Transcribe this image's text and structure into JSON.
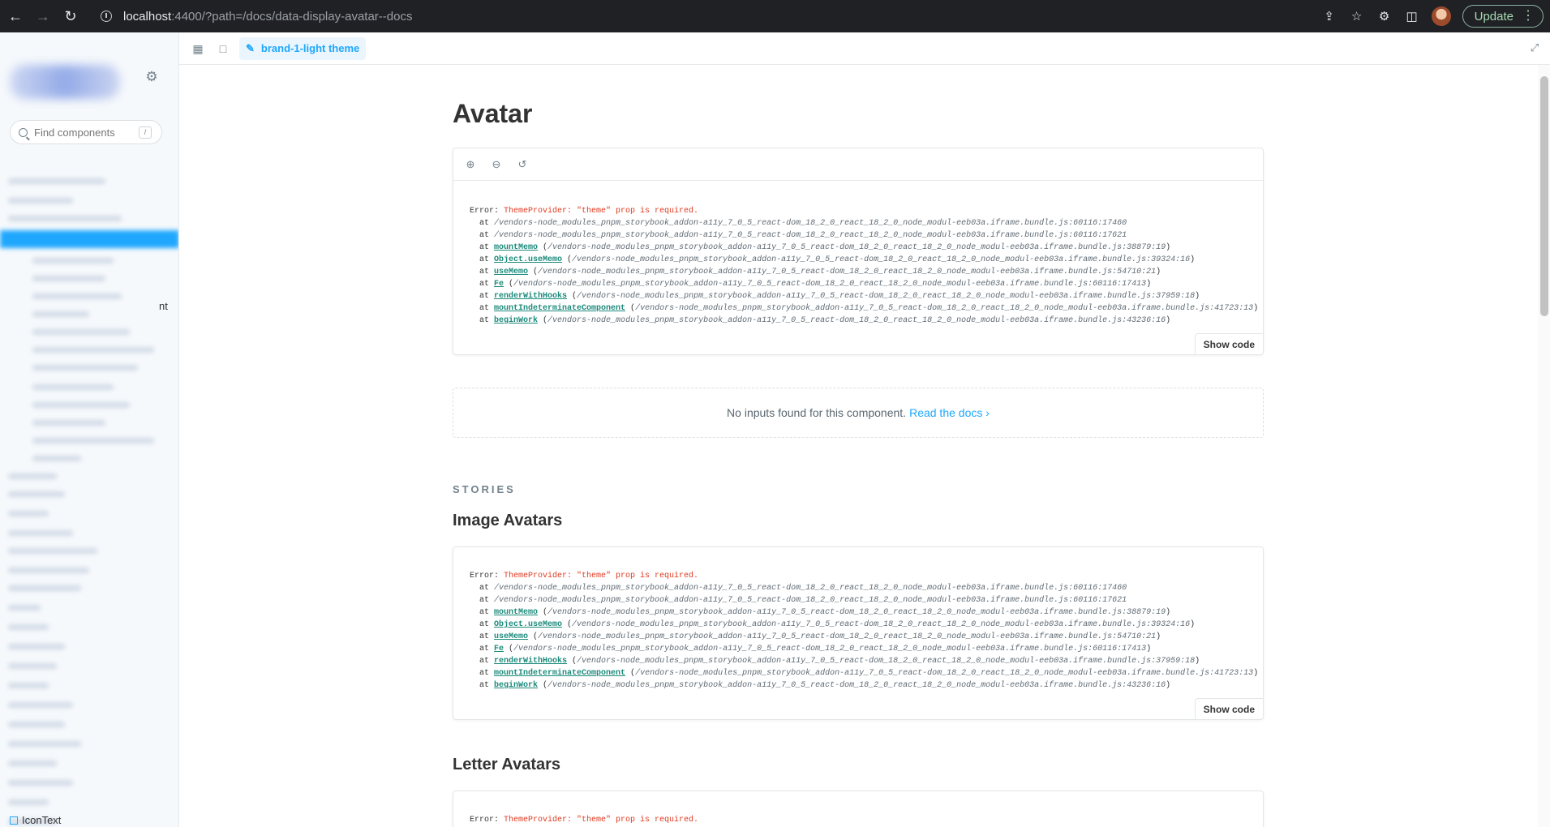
{
  "browser": {
    "url_host": "localhost",
    "url_path": ":4400/?path=/docs/data-display-avatar--docs",
    "update_label": "Update"
  },
  "sidebar": {
    "search_placeholder": "Find components",
    "search_shortcut": "/",
    "tree_fragment": "nt",
    "last_item_label": "IconText"
  },
  "toolbar": {
    "theme_label": "brand-1-light theme"
  },
  "page": {
    "title": "Avatar",
    "show_code_label": "Show code",
    "no_inputs_text": "No inputs found for this component.",
    "read_docs_label": "Read the docs",
    "stories_heading": "STORIES",
    "story_titles": [
      "Image Avatars",
      "Letter Avatars"
    ]
  },
  "error": {
    "prefix": "Error: ",
    "message": "ThemeProvider: \"theme\" prop is required.",
    "frames": [
      {
        "fn": "",
        "loc": "/vendors-node_modules_pnpm_storybook_addon-a11y_7_0_5_react-dom_18_2_0_react_18_2_0_node_modul-eeb03a.iframe.bundle.js:60116:17460"
      },
      {
        "fn": "",
        "loc": "/vendors-node_modules_pnpm_storybook_addon-a11y_7_0_5_react-dom_18_2_0_react_18_2_0_node_modul-eeb03a.iframe.bundle.js:60116:17621"
      },
      {
        "fn": "mountMemo",
        "loc": "/vendors-node_modules_pnpm_storybook_addon-a11y_7_0_5_react-dom_18_2_0_react_18_2_0_node_modul-eeb03a.iframe.bundle.js:38879:19"
      },
      {
        "fn": "Object.useMemo",
        "loc": "/vendors-node_modules_pnpm_storybook_addon-a11y_7_0_5_react-dom_18_2_0_react_18_2_0_node_modul-eeb03a.iframe.bundle.js:39324:16"
      },
      {
        "fn": "useMemo",
        "loc": "/vendors-node_modules_pnpm_storybook_addon-a11y_7_0_5_react-dom_18_2_0_react_18_2_0_node_modul-eeb03a.iframe.bundle.js:54710:21"
      },
      {
        "fn": "Fe",
        "loc": "/vendors-node_modules_pnpm_storybook_addon-a11y_7_0_5_react-dom_18_2_0_react_18_2_0_node_modul-eeb03a.iframe.bundle.js:60116:17413"
      },
      {
        "fn": "renderWithHooks",
        "loc": "/vendors-node_modules_pnpm_storybook_addon-a11y_7_0_5_react-dom_18_2_0_react_18_2_0_node_modul-eeb03a.iframe.bundle.js:37959:18"
      },
      {
        "fn": "mountIndeterminateComponent",
        "loc": "/vendors-node_modules_pnpm_storybook_addon-a11y_7_0_5_react-dom_18_2_0_react_18_2_0_node_modul-eeb03a.iframe.bundle.js:41723:13"
      },
      {
        "fn": "beginWork",
        "loc": "/vendors-node_modules_pnpm_storybook_addon-a11y_7_0_5_react-dom_18_2_0_react_18_2_0_node_modul-eeb03a.iframe.bundle.js:43236:16"
      }
    ],
    "truncated_frames": 1
  },
  "colors": {
    "accent": "#1ea7fd",
    "error_red": "#e0391f",
    "fn_teal": "#1b8a7b",
    "browser_chrome": "#202124"
  },
  "icons": {
    "back": "back-arrow-icon",
    "forward": "forward-arrow-icon",
    "reload": "reload-icon",
    "site_info": "site-info-icon",
    "share": "share-icon",
    "bookmark": "star-icon",
    "extensions": "puzzle-icon",
    "side_panel": "side-panel-icon",
    "settings": "gear-icon",
    "search": "search-icon",
    "grid": "grid-icon",
    "outline": "outline-icon",
    "theme": "pencil-icon",
    "fullscreen": "fullscreen-icon",
    "zoom_in": "zoom-in-icon",
    "zoom_out": "zoom-out-icon",
    "zoom_reset": "zoom-reset-icon",
    "chevron": "chevron-right-icon"
  }
}
